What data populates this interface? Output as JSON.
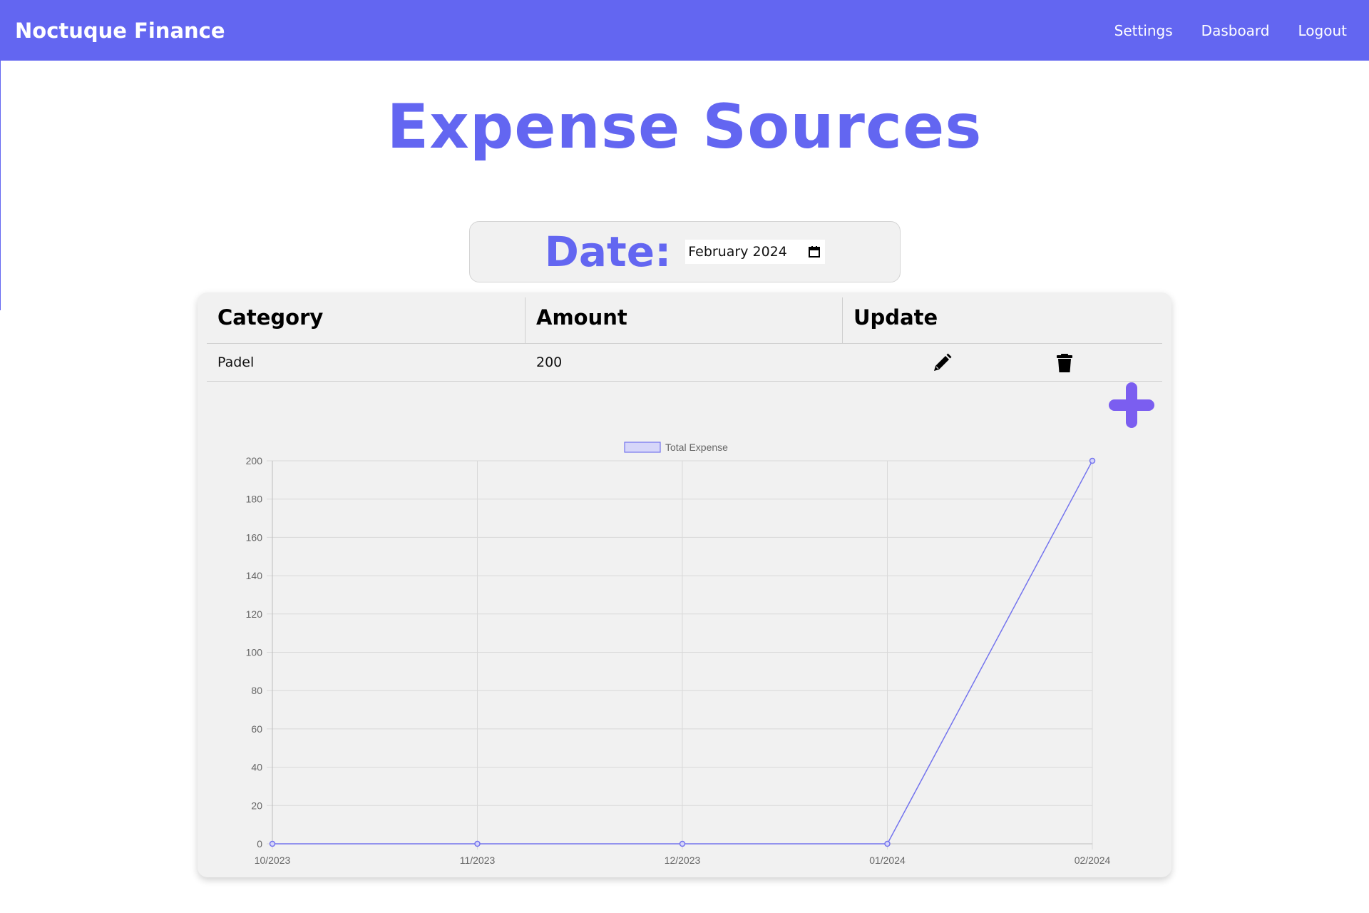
{
  "nav": {
    "brand": "Noctuque Finance",
    "links": [
      {
        "label": "Settings"
      },
      {
        "label": "Dasboard"
      },
      {
        "label": "Logout"
      }
    ]
  },
  "page": {
    "title": "Expense Sources"
  },
  "date_filter": {
    "label": "Date:",
    "value": "February 2024"
  },
  "table": {
    "headers": [
      "Category",
      "Amount",
      "Update"
    ],
    "rows": [
      {
        "category": "Padel",
        "amount": "200",
        "edit_icon": "pencil-icon",
        "delete_icon": "trash-icon"
      }
    ]
  },
  "add_button": {
    "icon": "plus-icon",
    "color": "#7b5ef0"
  },
  "colors": {
    "brand": "#6366f1",
    "card_bg": "#f1f1f1",
    "series_line": "#7474ee",
    "series_fill": "#d6d6f9"
  },
  "chart_data": {
    "type": "line",
    "categories": [
      "10/2023",
      "11/2023",
      "12/2023",
      "01/2024",
      "02/2024"
    ],
    "series": [
      {
        "name": "Total Expense",
        "values": [
          0,
          0,
          0,
          0,
          200
        ]
      }
    ],
    "ylim": [
      0,
      200
    ],
    "yticks": [
      0,
      20,
      40,
      60,
      80,
      100,
      120,
      140,
      160,
      180,
      200
    ],
    "grid": true,
    "legend": "top-center"
  }
}
